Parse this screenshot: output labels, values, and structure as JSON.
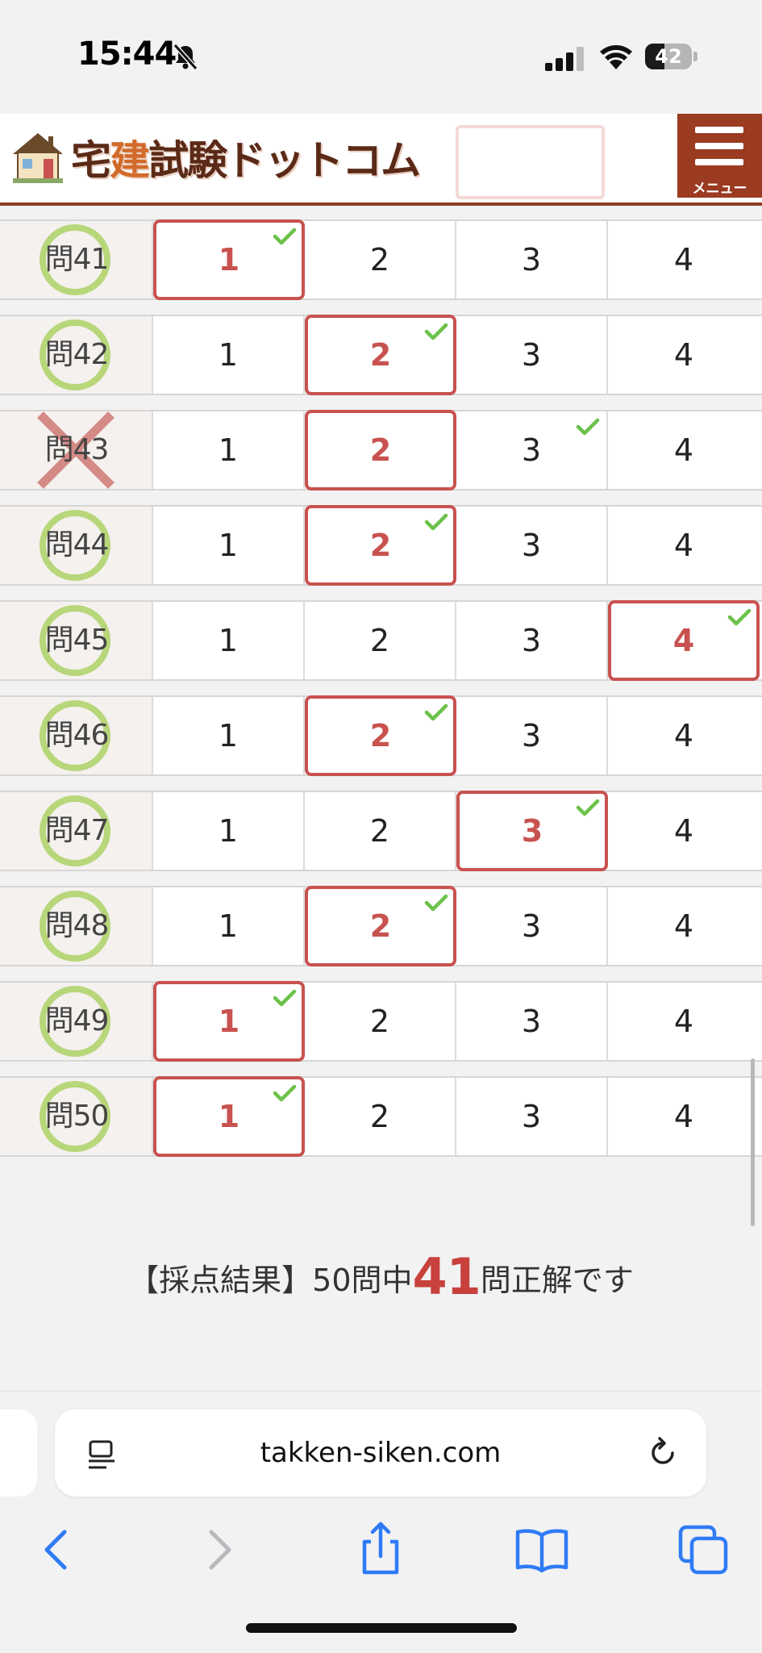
{
  "status_bar": {
    "time": "15:44",
    "battery_level": "42",
    "battery_fraction": 0.42
  },
  "header": {
    "logo_text_a": "宅",
    "logo_text_accent": "建",
    "logo_text_b": "試験ドットコム",
    "menu_label": "メニュー"
  },
  "colors": {
    "accent_red": "#c8524f",
    "correct_green": "#b8d67a",
    "check_green": "#6cc24a",
    "wrong_x": "#d48a86",
    "brand_brown": "#9a3b22"
  },
  "questions": [
    {
      "label": "問41",
      "result": "correct",
      "selected": 1,
      "answer": 1
    },
    {
      "label": "問42",
      "result": "correct",
      "selected": 2,
      "answer": 2
    },
    {
      "label": "問43",
      "result": "wrong",
      "selected": 2,
      "answer": 3
    },
    {
      "label": "問44",
      "result": "correct",
      "selected": 2,
      "answer": 2
    },
    {
      "label": "問45",
      "result": "correct",
      "selected": 4,
      "answer": 4
    },
    {
      "label": "問46",
      "result": "correct",
      "selected": 2,
      "answer": 2
    },
    {
      "label": "問47",
      "result": "correct",
      "selected": 3,
      "answer": 3
    },
    {
      "label": "問48",
      "result": "correct",
      "selected": 2,
      "answer": 2
    },
    {
      "label": "問49",
      "result": "correct",
      "selected": 1,
      "answer": 1
    },
    {
      "label": "問50",
      "result": "correct",
      "selected": 1,
      "answer": 1
    }
  ],
  "choice_labels": [
    "1",
    "2",
    "3",
    "4"
  ],
  "result": {
    "prefix": "【採点結果】50問中",
    "score": "41",
    "suffix": "問正解です"
  },
  "browser": {
    "url": "takken-siken.com"
  },
  "icons": {
    "status": [
      "bell-slash-icon",
      "cellular-signal-icon",
      "wifi-icon",
      "battery-icon"
    ],
    "toolbar": [
      "back-icon",
      "forward-icon",
      "share-icon",
      "bookmarks-icon",
      "tabs-icon"
    ],
    "address": [
      "reader-mode-icon",
      "reload-icon"
    ]
  }
}
